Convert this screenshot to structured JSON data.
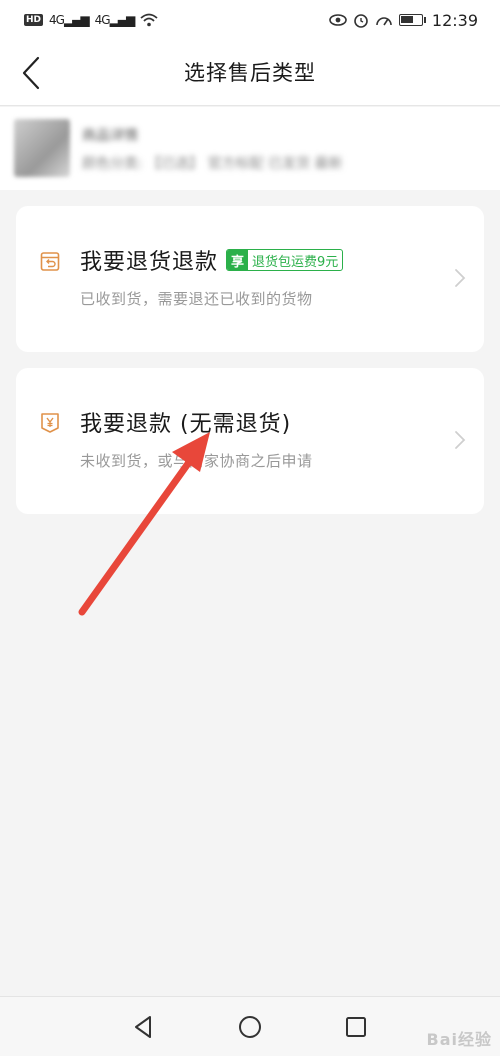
{
  "status_bar": {
    "network_1": "4G",
    "network_2": "4G",
    "time": "12:39"
  },
  "nav": {
    "title": "选择售后类型"
  },
  "product": {
    "name": "商品详情",
    "desc": "颜色分类:  【已选】 官方标配 已发货 最新"
  },
  "options": [
    {
      "title": "我要退货退款",
      "promo_head": "享",
      "promo_body": "退货包运费9元",
      "subtitle": "已收到货，需要退还已收到的货物",
      "icon": "return-box-icon"
    },
    {
      "title": "我要退款 (无需退货)",
      "subtitle": "未收到货，或与商家协商之后申请",
      "icon": "refund-yen-icon"
    }
  ],
  "watermark": "Bai经验",
  "colors": {
    "accent_orange": "#e0924a",
    "promo_green": "#2bb04a",
    "annotation_red": "#e8473a"
  }
}
